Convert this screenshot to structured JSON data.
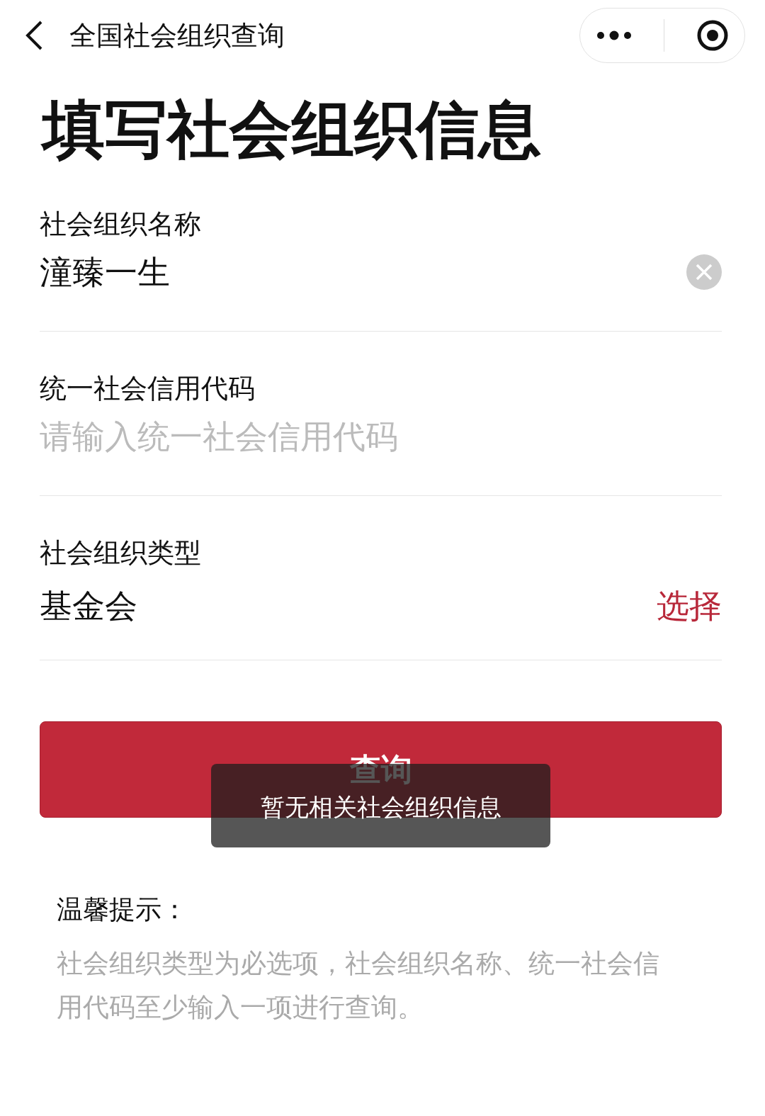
{
  "nav": {
    "title": "全国社会组织查询"
  },
  "heading": "填写社会组织信息",
  "fields": [
    {
      "kind": "input",
      "label": "社会组织名称",
      "value": "潼臻一生",
      "clearable": true
    },
    {
      "kind": "input",
      "label": "统一社会信用代码",
      "placeholder": "请输入统一社会信用代码"
    },
    {
      "kind": "select",
      "label": "社会组织类型",
      "value": "基金会",
      "action": "选择"
    }
  ],
  "query_button": "查询",
  "toast": "暂无相关社会组织信息",
  "tip": {
    "title": "温馨提示：",
    "text": "社会组织类型为必选项，社会组织名称、统一社会信用代码至少输入一项进行查询。"
  }
}
